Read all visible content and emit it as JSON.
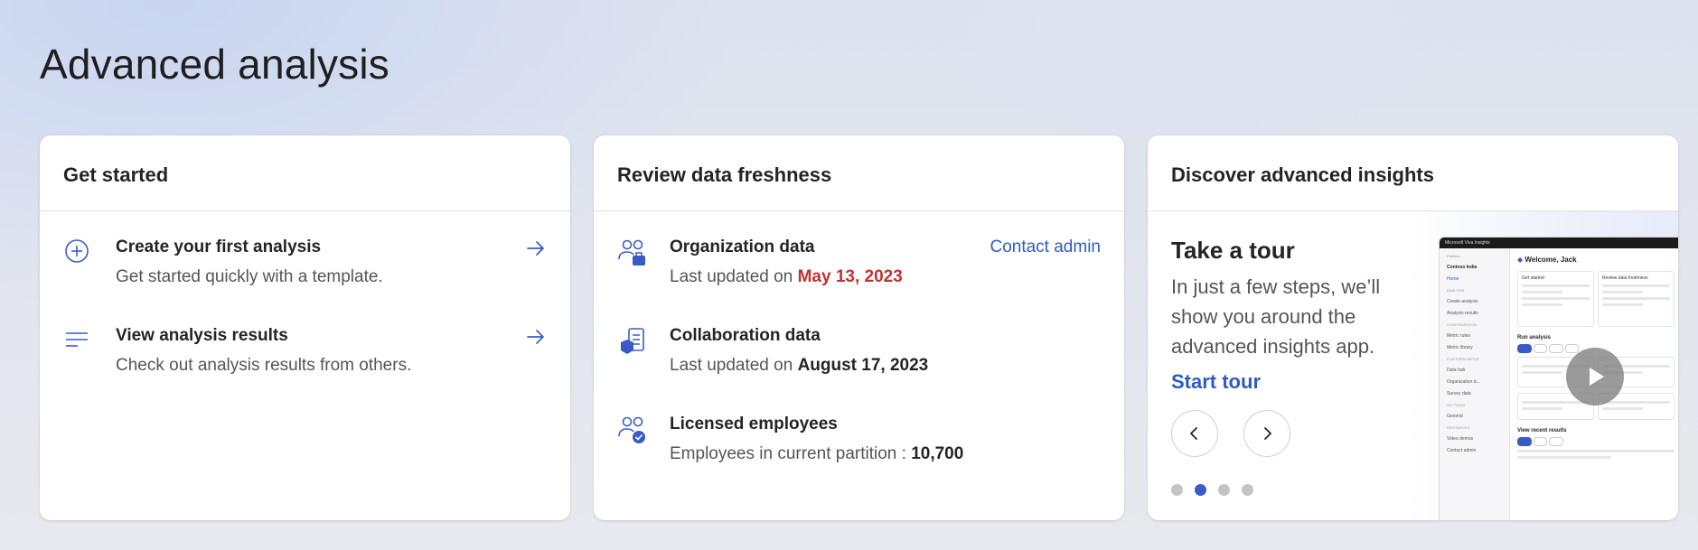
{
  "page": {
    "title": "Advanced analysis"
  },
  "get_started": {
    "header": "Get started",
    "items": [
      {
        "title": "Create your first analysis",
        "sub": "Get started quickly with a template.",
        "icon": "add-circle-icon"
      },
      {
        "title": "View analysis results",
        "sub": "Check out analysis results from others.",
        "icon": "list-icon"
      }
    ]
  },
  "freshness": {
    "header": "Review data freshness",
    "org": {
      "title": "Organization data",
      "prefix": "Last updated on",
      "date": "May 13, 2023",
      "action": "Contact admin"
    },
    "collab": {
      "title": "Collaboration data",
      "prefix": "Last updated on",
      "date": "August 17, 2023"
    },
    "licensed": {
      "title": "Licensed employees",
      "prefix": "Employees in current partition :",
      "value": "10,700"
    }
  },
  "discover": {
    "header": "Discover advanced insights",
    "tour_title": "Take a tour",
    "tour_desc": "In just a few steps, we’ll show you around the advanced insights app.",
    "tour_link": "Start tour",
    "dots": 4,
    "active_dot": 2,
    "preview": {
      "app_name": "Microsoft Viva Insights",
      "workspace_label": "Partition",
      "workspace": "Contoso India",
      "welcome": "Welcome, Jack",
      "nav": [
        "Home",
        "ANALYSIS",
        "Create analysis",
        "Analysis results",
        "CONFIGURATION",
        "Metric rules",
        "Metric library",
        "PLATFORM SETUP",
        "Data hub",
        "Organization d...",
        "Survey data",
        "SETTINGS",
        "General",
        "RESOURCES",
        "Video demos",
        "Contact admin"
      ],
      "get_started": "Get started",
      "review": "Review data freshness",
      "run_analysis": "Run analysis",
      "recent": "View recent results"
    }
  },
  "colors": {
    "accent": "#2f5bc5",
    "date_red": "#c4312e",
    "dot_active": "#3a5bc7"
  }
}
